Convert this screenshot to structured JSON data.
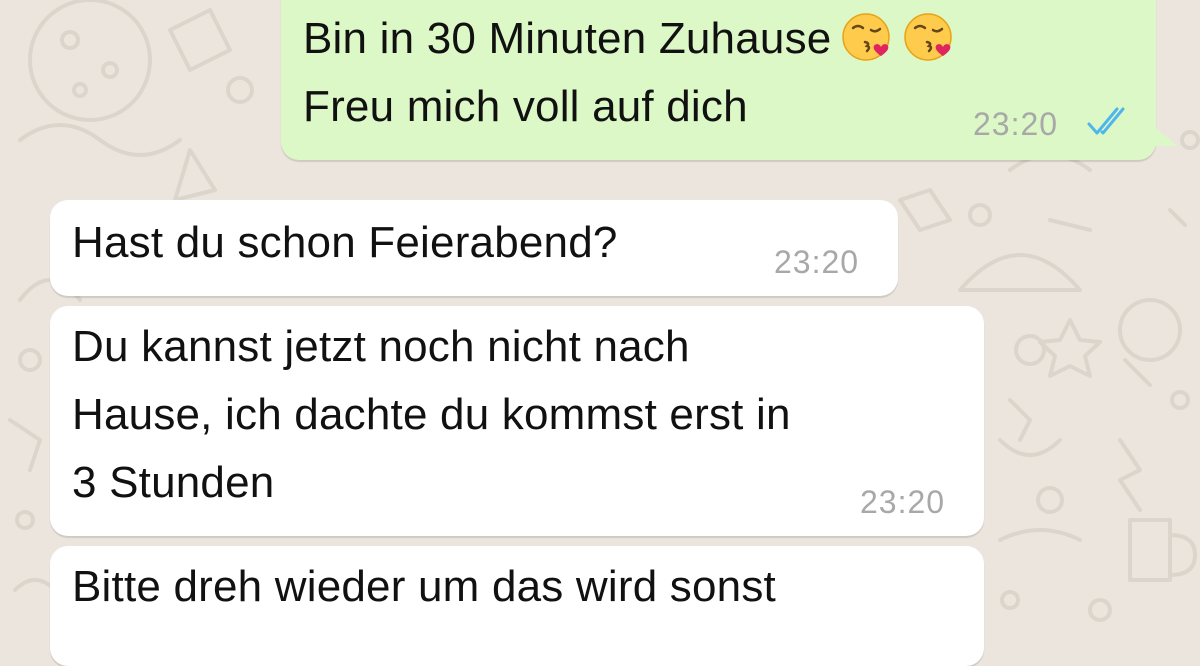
{
  "messages": [
    {
      "direction": "outgoing",
      "lines": [
        "Bin in 30 Minuten Zuhause",
        "Freu mich voll auf dich"
      ],
      "emojis": [
        "face-blowing-kiss-icon",
        "face-blowing-kiss-icon"
      ],
      "time": "23:20",
      "status": "read-double-check-icon"
    },
    {
      "direction": "incoming",
      "lines": [
        "Hast du schon Feierabend?"
      ],
      "time": "23:20"
    },
    {
      "direction": "incoming",
      "lines": [
        "Du kannst jetzt noch nicht nach",
        "Hause, ich dachte du kommst erst in",
        "3 Stunden"
      ],
      "time": "23:20"
    },
    {
      "direction": "incoming",
      "lines": [
        "Bitte dreh wieder um das wird sonst"
      ]
    }
  ],
  "colors": {
    "outgoing_bubble": "#DCF8C6",
    "incoming_bubble": "#FFFFFF",
    "wallpaper": "#ECE5DD",
    "read_ticks": "#4FB6EC",
    "timestamp": "#A8A8A8"
  }
}
